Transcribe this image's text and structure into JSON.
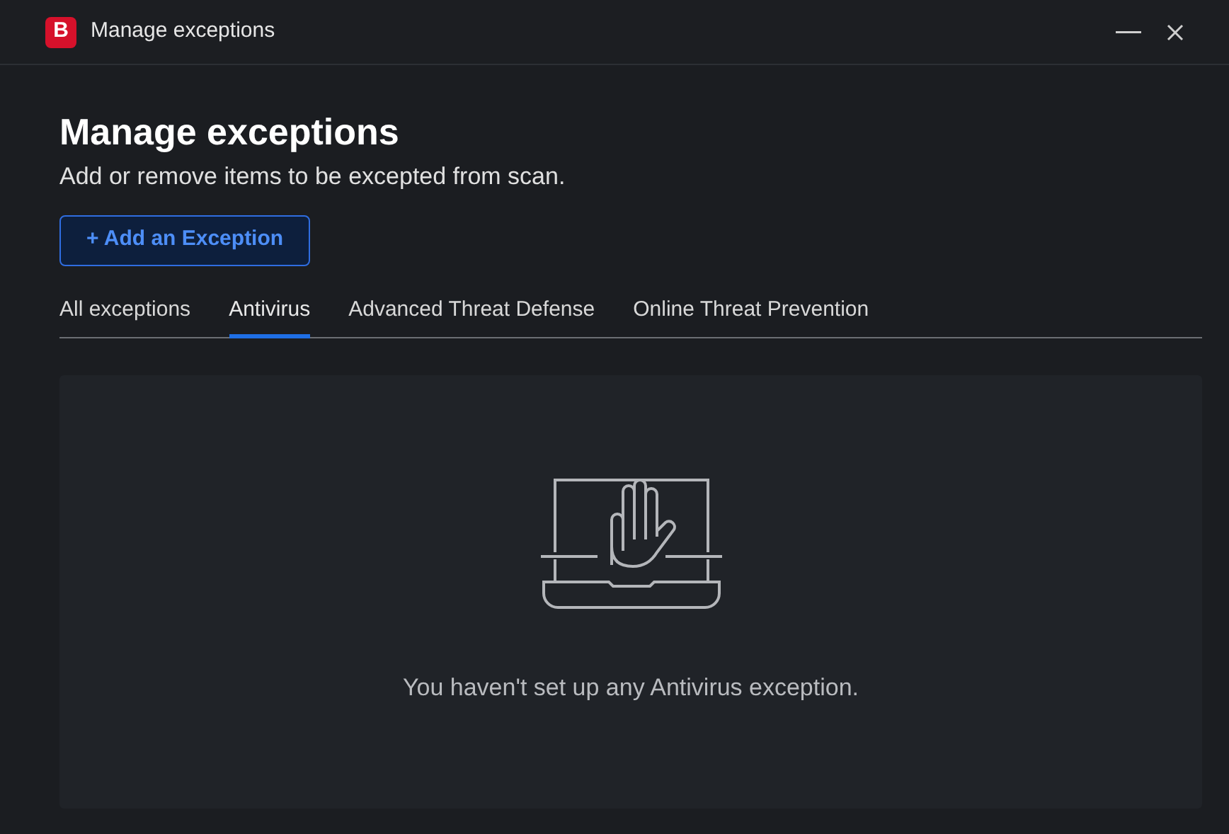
{
  "window": {
    "logo": "B",
    "title": "Manage exceptions"
  },
  "heading": "Manage exceptions",
  "subtitle": "Add or remove items to be excepted from scan.",
  "add_button": "+ Add an Exception",
  "tabs": [
    {
      "label": "All exceptions",
      "selected": false
    },
    {
      "label": "Antivirus",
      "selected": true
    },
    {
      "label": "Advanced Threat Defense",
      "selected": false
    },
    {
      "label": "Online Threat Prevention",
      "selected": false
    }
  ],
  "empty_state": {
    "message": "You haven't set up any Antivirus exception."
  }
}
